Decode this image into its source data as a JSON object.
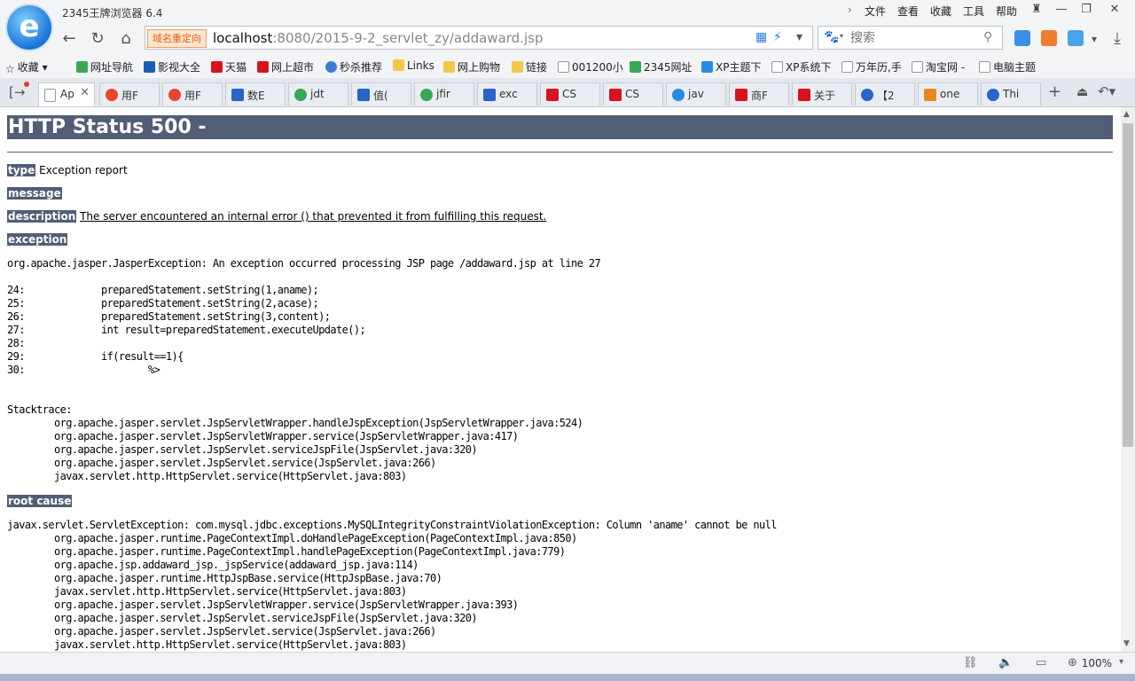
{
  "window": {
    "title": "2345王牌浏览器 6.4",
    "menu": [
      "文件",
      "查看",
      "收藏",
      "工具",
      "帮助"
    ]
  },
  "nav": {
    "redirect_badge": "域名重定向",
    "url_host": "localhost",
    "url_rest": ":8080/2015-9-2_servlet_zy/addaward.jsp",
    "search_placeholder": "搜索"
  },
  "bookmarks": [
    "收藏",
    "网址导航",
    "影视大全",
    "天猫",
    "网上超市",
    "秒杀推荐",
    "Links",
    "网上购物",
    "链接",
    "001200小",
    "2345网址",
    "XP主题下",
    "XP系统下",
    "万年历,手",
    "淘宝网 -",
    "电脑主题"
  ],
  "tabs": [
    "Ap",
    "用F",
    "用F",
    "数E",
    "jdt",
    "值(",
    "jfir",
    "exc",
    "CS",
    "CS",
    "jav",
    "商F",
    "关于",
    "【2",
    "one",
    "Thi"
  ],
  "page": {
    "heading": "HTTP Status 500 -",
    "type_label": "type",
    "type_value": "Exception report",
    "message_label": "message",
    "description_label": "description",
    "description_value": "The server encountered an internal error () that prevented it from fulfilling this request.",
    "exception_label": "exception",
    "exception_text": "org.apache.jasper.JasperException: An exception occurred processing JSP page /addaward.jsp at line 27\n\n24:             preparedStatement.setString(1,aname);\n25:             preparedStatement.setString(2,acase);\n26:             preparedStatement.setString(3,content);\n27:             int result=preparedStatement.executeUpdate();\n28: \n29:             if(result==1){\n30:                     %>\n\n\nStacktrace:\n\torg.apache.jasper.servlet.JspServletWrapper.handleJspException(JspServletWrapper.java:524)\n\torg.apache.jasper.servlet.JspServletWrapper.service(JspServletWrapper.java:417)\n\torg.apache.jasper.servlet.JspServlet.serviceJspFile(JspServlet.java:320)\n\torg.apache.jasper.servlet.JspServlet.service(JspServlet.java:266)\n\tjavax.servlet.http.HttpServlet.service(HttpServlet.java:803)",
    "root_cause_label": "root cause",
    "root_cause_text": "javax.servlet.ServletException: com.mysql.jdbc.exceptions.MySQLIntegrityConstraintViolationException: Column 'aname' cannot be null\n\torg.apache.jasper.runtime.PageContextImpl.doHandlePageException(PageContextImpl.java:850)\n\torg.apache.jasper.runtime.PageContextImpl.handlePageException(PageContextImpl.java:779)\n\torg.apache.jsp.addaward_jsp._jspService(addaward_jsp.java:114)\n\torg.apache.jasper.runtime.HttpJspBase.service(HttpJspBase.java:70)\n\tjavax.servlet.http.HttpServlet.service(HttpServlet.java:803)\n\torg.apache.jasper.servlet.JspServletWrapper.service(JspServletWrapper.java:393)\n\torg.apache.jasper.servlet.JspServlet.serviceJspFile(JspServlet.java:320)\n\torg.apache.jasper.servlet.JspServlet.service(JspServlet.java:266)\n\tjavax.servlet.http.HttpServlet.service(HttpServlet.java:803)"
  },
  "status": {
    "zoom": "100%"
  },
  "colors": {
    "header_bg": "#525d76",
    "tab_bar": "#e4e8ee"
  }
}
